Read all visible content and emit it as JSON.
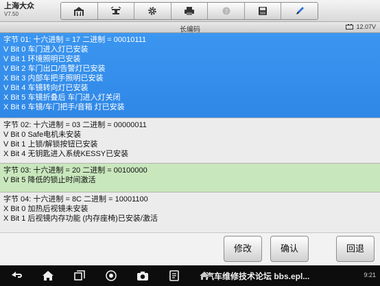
{
  "app": {
    "name": "上海大众",
    "version": "V7.50"
  },
  "toolbar": {
    "icons": [
      "home-icon",
      "vehicle-lift-icon",
      "gear-icon",
      "printer-icon",
      "help-icon",
      "save-icon",
      "pen-icon"
    ]
  },
  "title": "长编码",
  "battery_voltage": "12.07V",
  "bytes": [
    {
      "header": "字节 01: 十六进制 = 17  二进制 = 00010111",
      "lines": [
        "V Bit 0 车门进入灯已安装",
        "V Bit 1 环境照明已安装",
        "V Bit 2 车门出口/告警灯已安装",
        "X Bit 3 内部车把手照明已安装",
        "V Bit 4 车镜转向灯已安装",
        "X Bit 5 车镜折叠后 车门进入灯关闭",
        "X Bit 6 车镜/车门把手/音箱 灯已安装"
      ]
    },
    {
      "header": "字节 02: 十六进制 = 03  二进制 = 00000011",
      "lines": [
        "V Bit 0 Safe电机未安装",
        "V Bit 1 上锁/解锁按钮已安装",
        "X Bit 4 无钥匙进入系统KESSY已安装"
      ]
    },
    {
      "header": "字节 03: 十六进制 = 20  二进制 = 00100000",
      "lines": [
        "V Bit 5 降低的锁止时间激活"
      ]
    },
    {
      "header": "字节 04: 十六进制 = 8C  二进制 = 10001100",
      "lines": [
        "X Bit 0 加热后视镜未安装",
        "X Bit 1 后视镜内存功能 (内存座椅)已安装/激活"
      ]
    }
  ],
  "actions": {
    "modify": "修改",
    "confirm": "确认",
    "back": "回退"
  },
  "navbar": {
    "icons": [
      "back-arrow-icon",
      "home-icon",
      "recent-apps-icon",
      "browser-icon",
      "camera-icon",
      "vci-icon",
      "home-small-icon"
    ],
    "watermark": "汽车维修技术论坛 bbs.epl...",
    "clock": "9:21"
  },
  "colors": {
    "selected": "#2f87e6",
    "highlight_green": "#c9e7bd",
    "row": "#ececec"
  }
}
